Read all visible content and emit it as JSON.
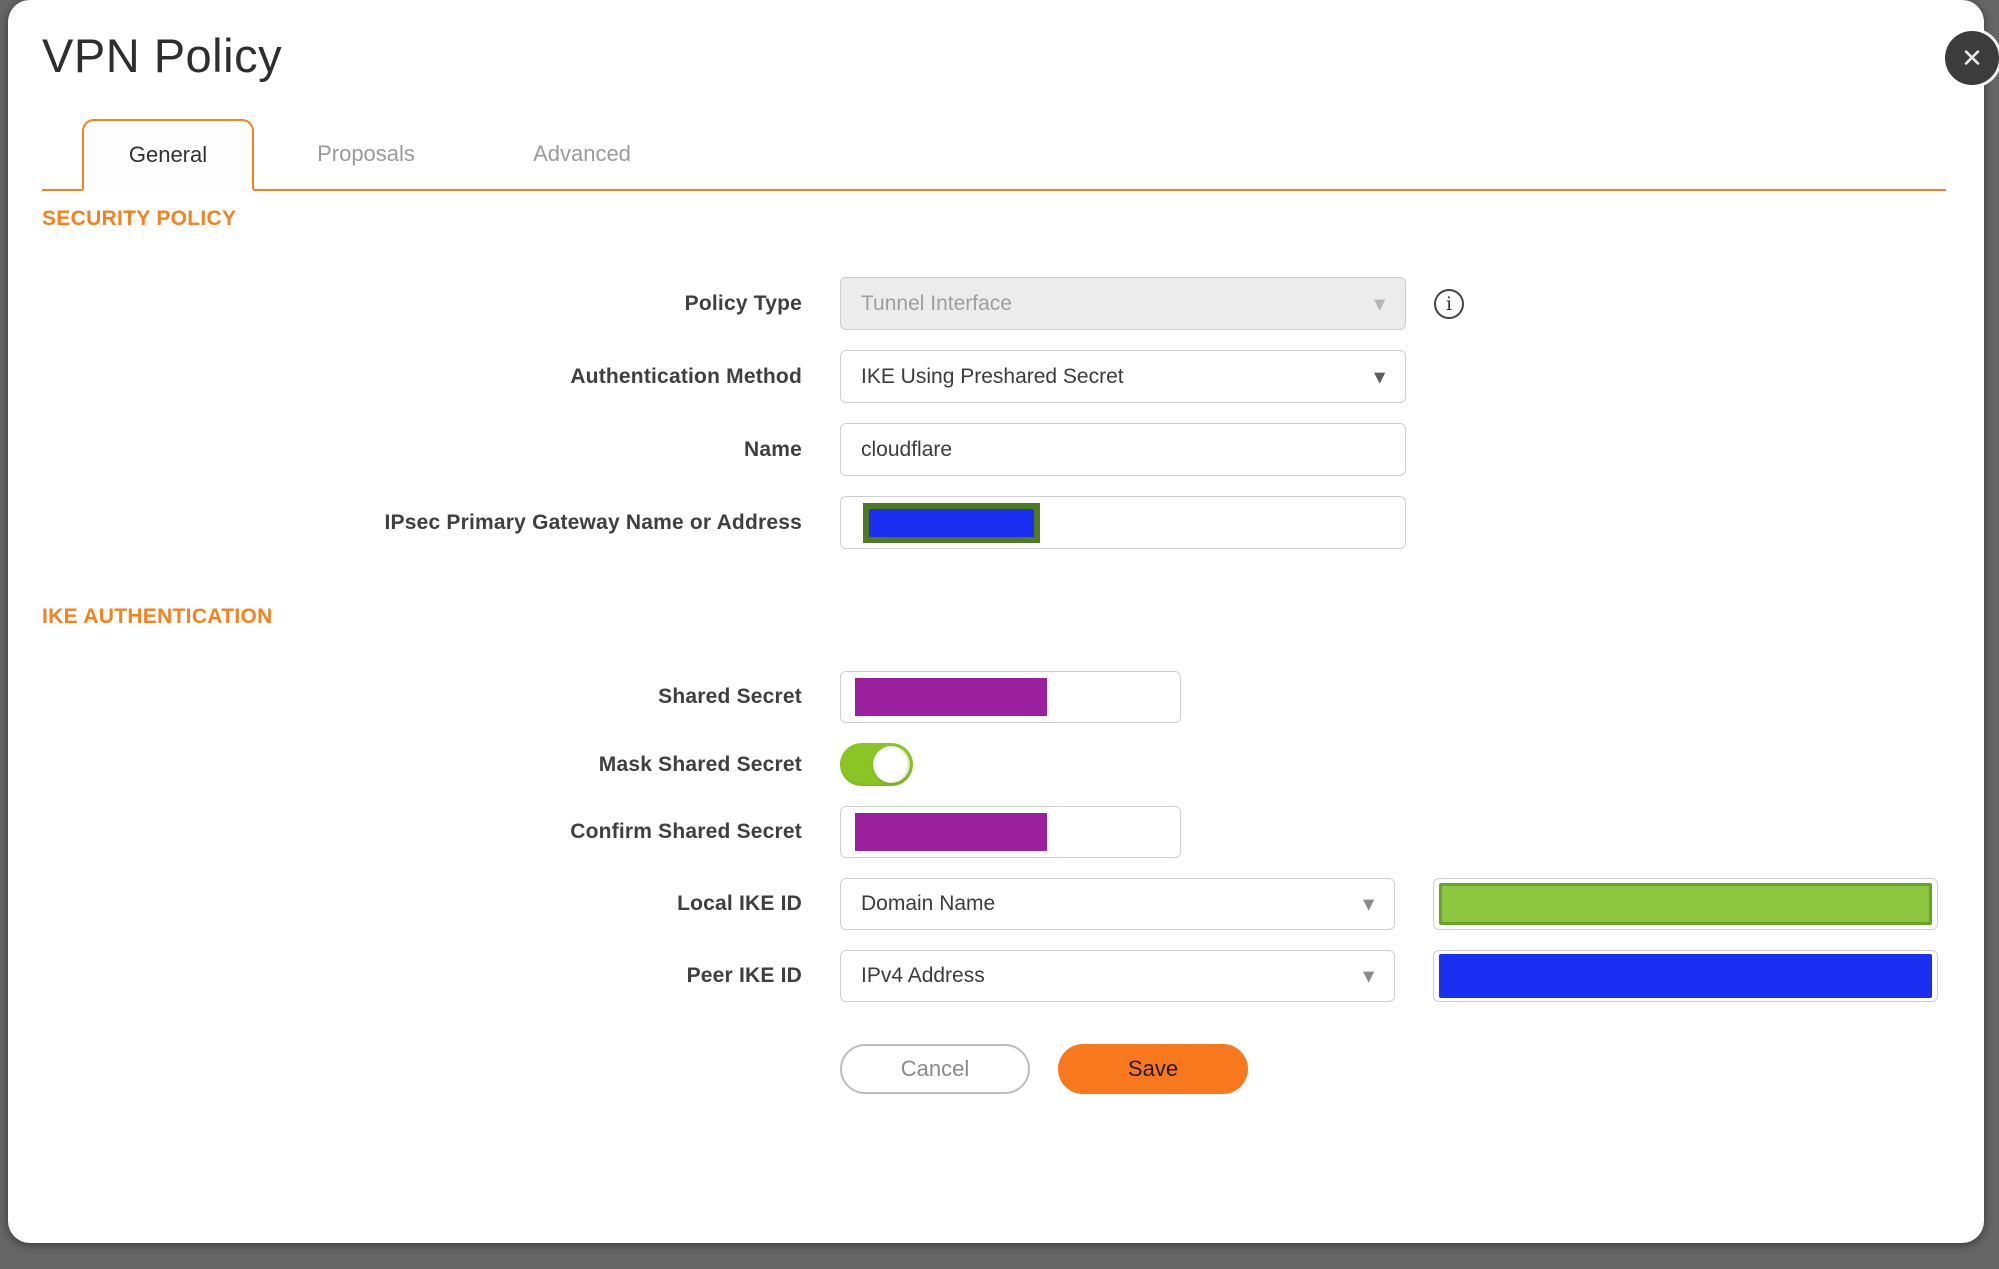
{
  "dialog": {
    "title": "VPN Policy"
  },
  "icons": {
    "close": "✕",
    "caret": "▼",
    "info": "i"
  },
  "tabs": [
    {
      "label": "General",
      "active": true
    },
    {
      "label": "Proposals",
      "active": false
    },
    {
      "label": "Advanced",
      "active": false
    }
  ],
  "sections": {
    "security_policy": {
      "heading": "SECURITY POLICY",
      "fields": {
        "policy_type": {
          "label": "Policy Type",
          "value": "Tunnel Interface",
          "disabled": true,
          "info_icon": true
        },
        "auth_method": {
          "label": "Authentication Method",
          "value": "IKE Using Preshared Secret"
        },
        "name": {
          "label": "Name",
          "value": "cloudflare"
        },
        "gateway": {
          "label": "IPsec Primary Gateway Name or Address",
          "value_redacted": true,
          "redaction_color": "#1b2ff2",
          "redaction_border": "#4e7b1f"
        }
      }
    },
    "ike_authentication": {
      "heading": "IKE AUTHENTICATION",
      "fields": {
        "shared_secret": {
          "label": "Shared Secret",
          "value_redacted": true,
          "redaction_color": "#9a209e"
        },
        "mask_shared_secret": {
          "label": "Mask Shared Secret",
          "state": "on"
        },
        "confirm_shared_secret": {
          "label": "Confirm Shared Secret",
          "value_redacted": true,
          "redaction_color": "#9a209e"
        },
        "local_ike_id": {
          "label": "Local IKE ID",
          "value": "Domain Name",
          "id_value_redacted": true,
          "id_redaction_color": "#8cc63f"
        },
        "peer_ike_id": {
          "label": "Peer IKE ID",
          "value": "IPv4 Address",
          "id_value_redacted": true,
          "id_redaction_color": "#1b2ff2"
        }
      }
    }
  },
  "buttons": {
    "cancel": "Cancel",
    "save": "Save"
  },
  "colors": {
    "accent_orange": "#F5821F",
    "save_orange": "#F8791D",
    "toggle_green": "#8BC524",
    "redact_purple": "#9A209E",
    "redact_blue": "#1B2FF2",
    "redact_green": "#8CC63F",
    "redact_green_border": "#6BA32A",
    "redact_olive_border": "#4E7B1F",
    "backdrop_gray": "#666667"
  }
}
